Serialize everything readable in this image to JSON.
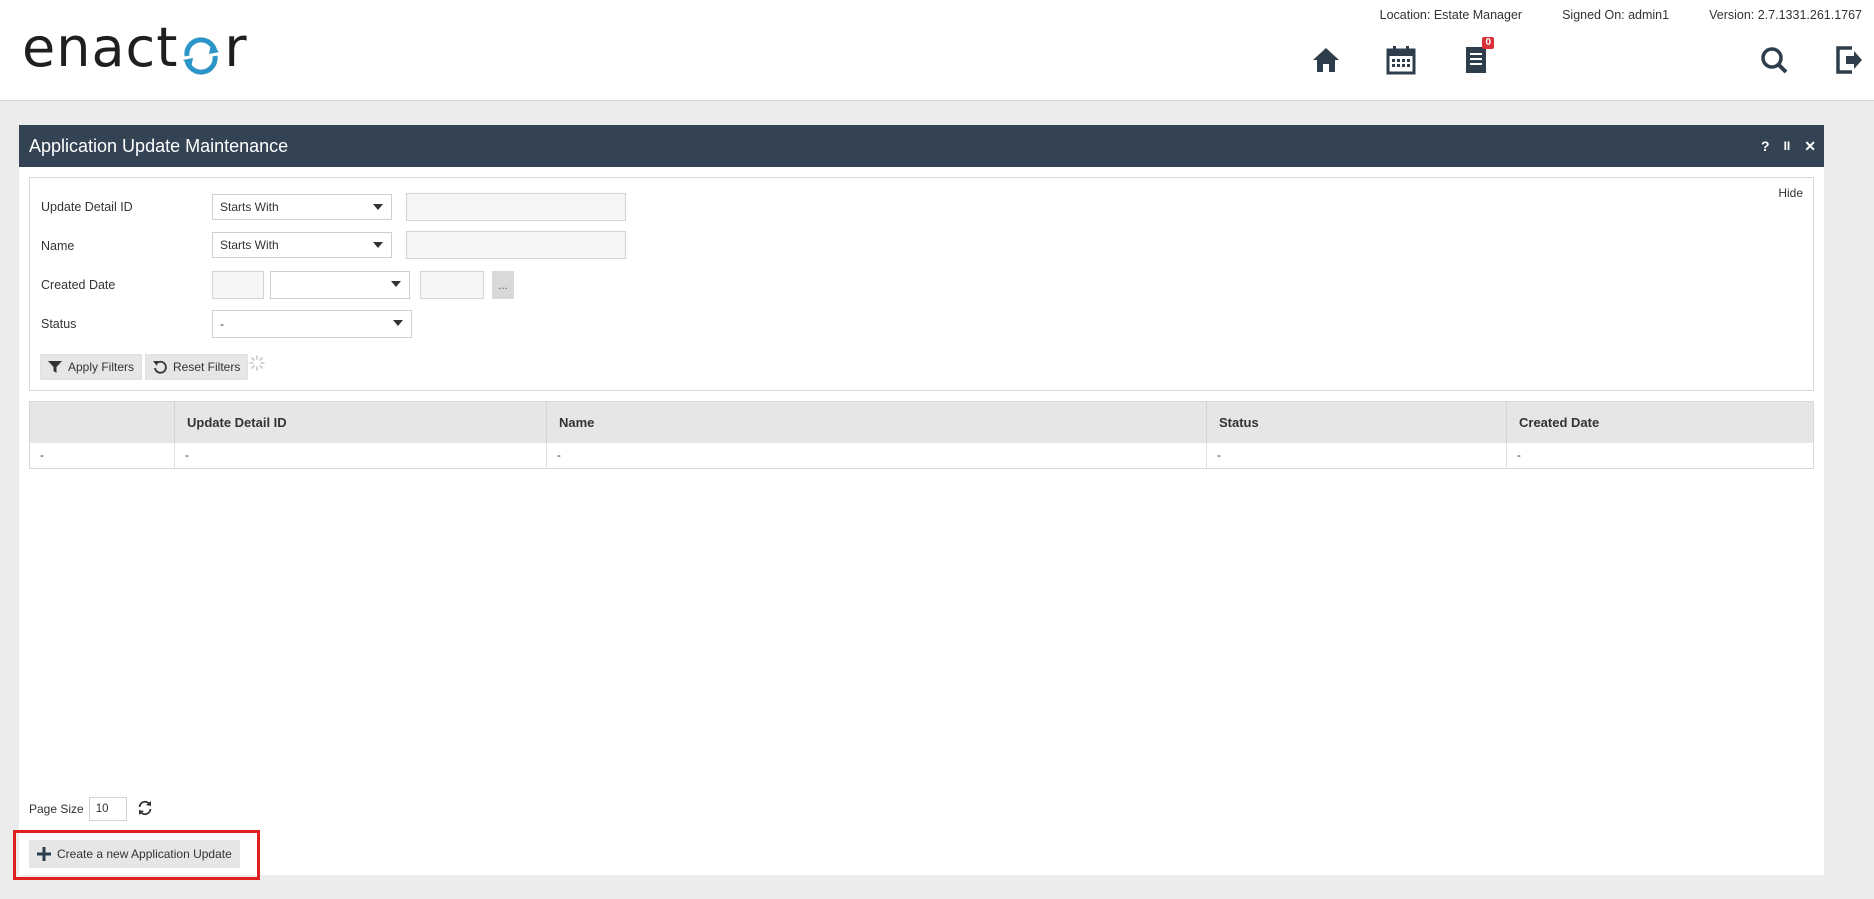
{
  "header": {
    "logo_text_left": "enact",
    "logo_text_right": "r",
    "location": "Location: Estate Manager",
    "signed_on": "Signed On: admin1",
    "version": "Version: 2.7.1331.261.1767",
    "notification_count": "0",
    "icons": [
      "home-icon",
      "calendar-icon",
      "document-icon",
      "search-icon",
      "logout-icon"
    ],
    "accent_color": "#2b95c8"
  },
  "panel": {
    "title": "Application Update Maintenance",
    "help": "?",
    "pause": "II",
    "close": "✕",
    "header_color": "#334353"
  },
  "filters": {
    "hide_label": "Hide",
    "rows": [
      {
        "label": "Update Detail ID",
        "operator": "Starts With",
        "value": ""
      },
      {
        "label": "Name",
        "operator": "Starts With",
        "value": ""
      },
      {
        "label": "Created Date",
        "operator": "",
        "value": ""
      },
      {
        "label": "Status",
        "operator": "-"
      }
    ],
    "date_picker_label": "...",
    "apply_label": "Apply Filters",
    "reset_label": "Reset Filters"
  },
  "table": {
    "columns": [
      "",
      "Update Detail ID",
      "Name",
      "Status",
      "Created Date"
    ],
    "rows": [
      [
        "-",
        "-",
        "-",
        "-",
        "-"
      ]
    ]
  },
  "footer": {
    "page_size_label": "Page Size",
    "page_size_value": "10",
    "create_label": "Create a new Application Update",
    "highlight_color": "#e02020"
  }
}
